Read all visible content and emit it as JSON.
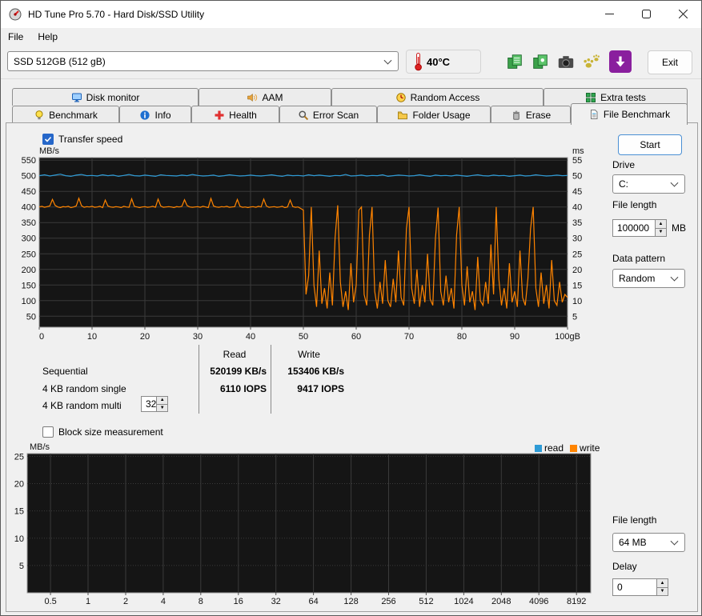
{
  "window": {
    "title": "HD Tune Pro 5.70 - Hard Disk/SSD Utility",
    "controls": [
      "minimize",
      "maximize",
      "close"
    ]
  },
  "menu": {
    "items": [
      {
        "label": "File"
      },
      {
        "label": "Help"
      }
    ]
  },
  "toolbar": {
    "drive_select_value": "SSD 512GB (512 gB)",
    "temperature": "40°C",
    "exit_label": "Exit",
    "icons": [
      "thermometer-icon",
      "copy-text-icon",
      "copy-image-icon",
      "camera-icon",
      "paws-icon",
      "download-icon"
    ]
  },
  "tabs": {
    "row1": [
      {
        "label": "Disk monitor",
        "icon": "disk-monitor-icon"
      },
      {
        "label": "AAM",
        "icon": "speaker-icon"
      },
      {
        "label": "Random Access",
        "icon": "random-access-icon"
      },
      {
        "label": "Extra tests",
        "icon": "extra-tests-icon"
      }
    ],
    "row2": [
      {
        "label": "Benchmark",
        "icon": "benchmark-icon"
      },
      {
        "label": "Info",
        "icon": "info-icon"
      },
      {
        "label": "Health",
        "icon": "health-icon"
      },
      {
        "label": "Error Scan",
        "icon": "error-scan-icon"
      },
      {
        "label": "Folder Usage",
        "icon": "folder-usage-icon"
      },
      {
        "label": "Erase",
        "icon": "erase-icon"
      },
      {
        "label": "File Benchmark",
        "icon": "file-benchmark-icon",
        "active": true
      }
    ],
    "active": "File Benchmark"
  },
  "file_benchmark": {
    "transfer_speed_label": "Transfer speed",
    "start_button": "Start",
    "drive_label": "Drive",
    "drive_value": "C:",
    "file_length_label": "File length",
    "file_length_value": "100000",
    "file_length_unit": "MB",
    "data_pattern_label": "Data pattern",
    "data_pattern_value": "Random"
  },
  "results": {
    "read_header": "Read",
    "write_header": "Write",
    "rows": [
      {
        "label": "Sequential",
        "read": "520199 KB/s",
        "write": "153406 KB/s"
      },
      {
        "label": "4 KB random single",
        "read": "6110 IOPS",
        "write": "9417 IOPS"
      },
      {
        "label": "4 KB random multi",
        "spin_value": "32"
      }
    ]
  },
  "block_size": {
    "checkbox_label": "Block size measurement",
    "file_length_label": "File length",
    "file_length_value": "64 MB",
    "delay_label": "Delay",
    "delay_value": "0"
  },
  "chart_data": [
    {
      "id": "transfer",
      "type": "line",
      "title": "Transfer speed",
      "xlim": [
        0,
        100
      ],
      "ylim": [
        15,
        558
      ],
      "x_ticks": [
        0,
        10,
        20,
        30,
        40,
        50,
        60,
        70,
        80,
        90,
        100
      ],
      "x_tick_labels": [
        "0",
        "10",
        "20",
        "30",
        "40",
        "50",
        "60",
        "70",
        "80",
        "90",
        "100gB"
      ],
      "x_grid": [
        10,
        20,
        30,
        40,
        50,
        60,
        70,
        80,
        90
      ],
      "y_grid": [
        50,
        100,
        150,
        200,
        250,
        300,
        350,
        400,
        450,
        500,
        550
      ],
      "y_left_ticks": [
        550,
        500,
        450,
        400,
        350,
        300,
        250,
        200,
        150,
        100,
        50
      ],
      "y_right_ticks": [
        55,
        50,
        45,
        40,
        35,
        30,
        25,
        20,
        15,
        10,
        5
      ],
      "y_left_label": "MB/s",
      "y_right_label": "ms",
      "bg": "#151515",
      "grid_color": "#3a3a3a",
      "border_color": "#9a9a9a",
      "series": [
        {
          "name": "read speed",
          "color": "#2e9bd6",
          "x_start": 0,
          "x_step": 1,
          "values": [
            500,
            503,
            499,
            502,
            505,
            500,
            498,
            502,
            504,
            500,
            501,
            499,
            503,
            500,
            502,
            498,
            501,
            504,
            500,
            499,
            502,
            500,
            498,
            503,
            501,
            500,
            499,
            502,
            500,
            504,
            501,
            499,
            500,
            502,
            498,
            500,
            503,
            501,
            499,
            500,
            502,
            500,
            499,
            501,
            503,
            500,
            498,
            502,
            500,
            501,
            499,
            503,
            500,
            502,
            500,
            498,
            501,
            500,
            504,
            499,
            500,
            502,
            499,
            501,
            500,
            503,
            498,
            500,
            502,
            501,
            499,
            500,
            503,
            500,
            498,
            502,
            500,
            501,
            499,
            502,
            500,
            498,
            501,
            503,
            500,
            499,
            502,
            500,
            501,
            498,
            500,
            502,
            499,
            500,
            503,
            501,
            499,
            500,
            502,
            500,
            501
          ]
        },
        {
          "name": "write speed",
          "color": "#ff8400",
          "x_start": 0,
          "x_step": 0.5,
          "values": [
            400,
            402,
            399,
            401,
            403,
            424,
            405,
            400,
            398,
            401,
            400,
            402,
            398,
            400,
            403,
            428,
            404,
            399,
            401,
            400,
            402,
            399,
            400,
            402,
            398,
            422,
            403,
            400,
            399,
            401,
            400,
            398,
            402,
            400,
            399,
            426,
            402,
            400,
            398,
            400,
            401,
            399,
            400,
            402,
            399,
            425,
            403,
            399,
            400,
            401,
            400,
            398,
            401,
            400,
            402,
            423,
            404,
            400,
            399,
            400,
            401,
            399,
            402,
            400,
            398,
            427,
            403,
            400,
            399,
            401,
            400,
            402,
            399,
            400,
            401,
            424,
            402,
            399,
            400,
            398,
            400,
            401,
            399,
            402,
            400,
            425,
            403,
            399,
            400,
            401,
            399,
            400,
            402,
            398,
            400,
            422,
            401,
            399,
            400,
            395,
            390,
            120,
            180,
            400,
            150,
            80,
            260,
            90,
            140,
            75,
            190,
            85,
            300,
            405,
            160,
            80,
            130,
            70,
            220,
            95,
            150,
            390,
            400,
            120,
            85,
            310,
            400,
            130,
            75,
            160,
            90,
            230,
            100,
            80,
            170,
            95,
            260,
            110,
            85,
            330,
            400,
            140,
            90,
            200,
            80,
            150,
            95,
            250,
            105,
            85,
            300,
            398,
            130,
            85,
            180,
            95,
            140,
            75,
            310,
            400,
            150,
            85,
            210,
            95,
            130,
            70,
            240,
            100,
            85,
            160,
            90,
            280,
            120,
            400,
            170,
            85,
            140,
            75,
            220,
            95,
            130,
            80,
            260,
            110,
            85,
            170,
            330,
            400,
            140,
            80,
            190,
            90,
            150,
            75,
            230,
            100,
            85,
            160,
            95,
            120,
            110
          ]
        }
      ]
    },
    {
      "id": "blocksize",
      "type": "line",
      "title": "Block size measurement",
      "categories": [
        "0.5",
        "1",
        "2",
        "4",
        "8",
        "16",
        "32",
        "64",
        "128",
        "256",
        "512",
        "1024",
        "2048",
        "4096",
        "8192"
      ],
      "ylim": [
        0,
        25.5
      ],
      "y_ticks": [
        25,
        20,
        15,
        10,
        5
      ],
      "y_label": "MB/s",
      "bg": "#151515",
      "grid_color": "#3a3a3a",
      "border_color": "#9a9a9a",
      "legend": [
        {
          "name": "read",
          "color": "#2e9bd6"
        },
        {
          "name": "write",
          "color": "#ff8400"
        }
      ],
      "series": []
    }
  ]
}
